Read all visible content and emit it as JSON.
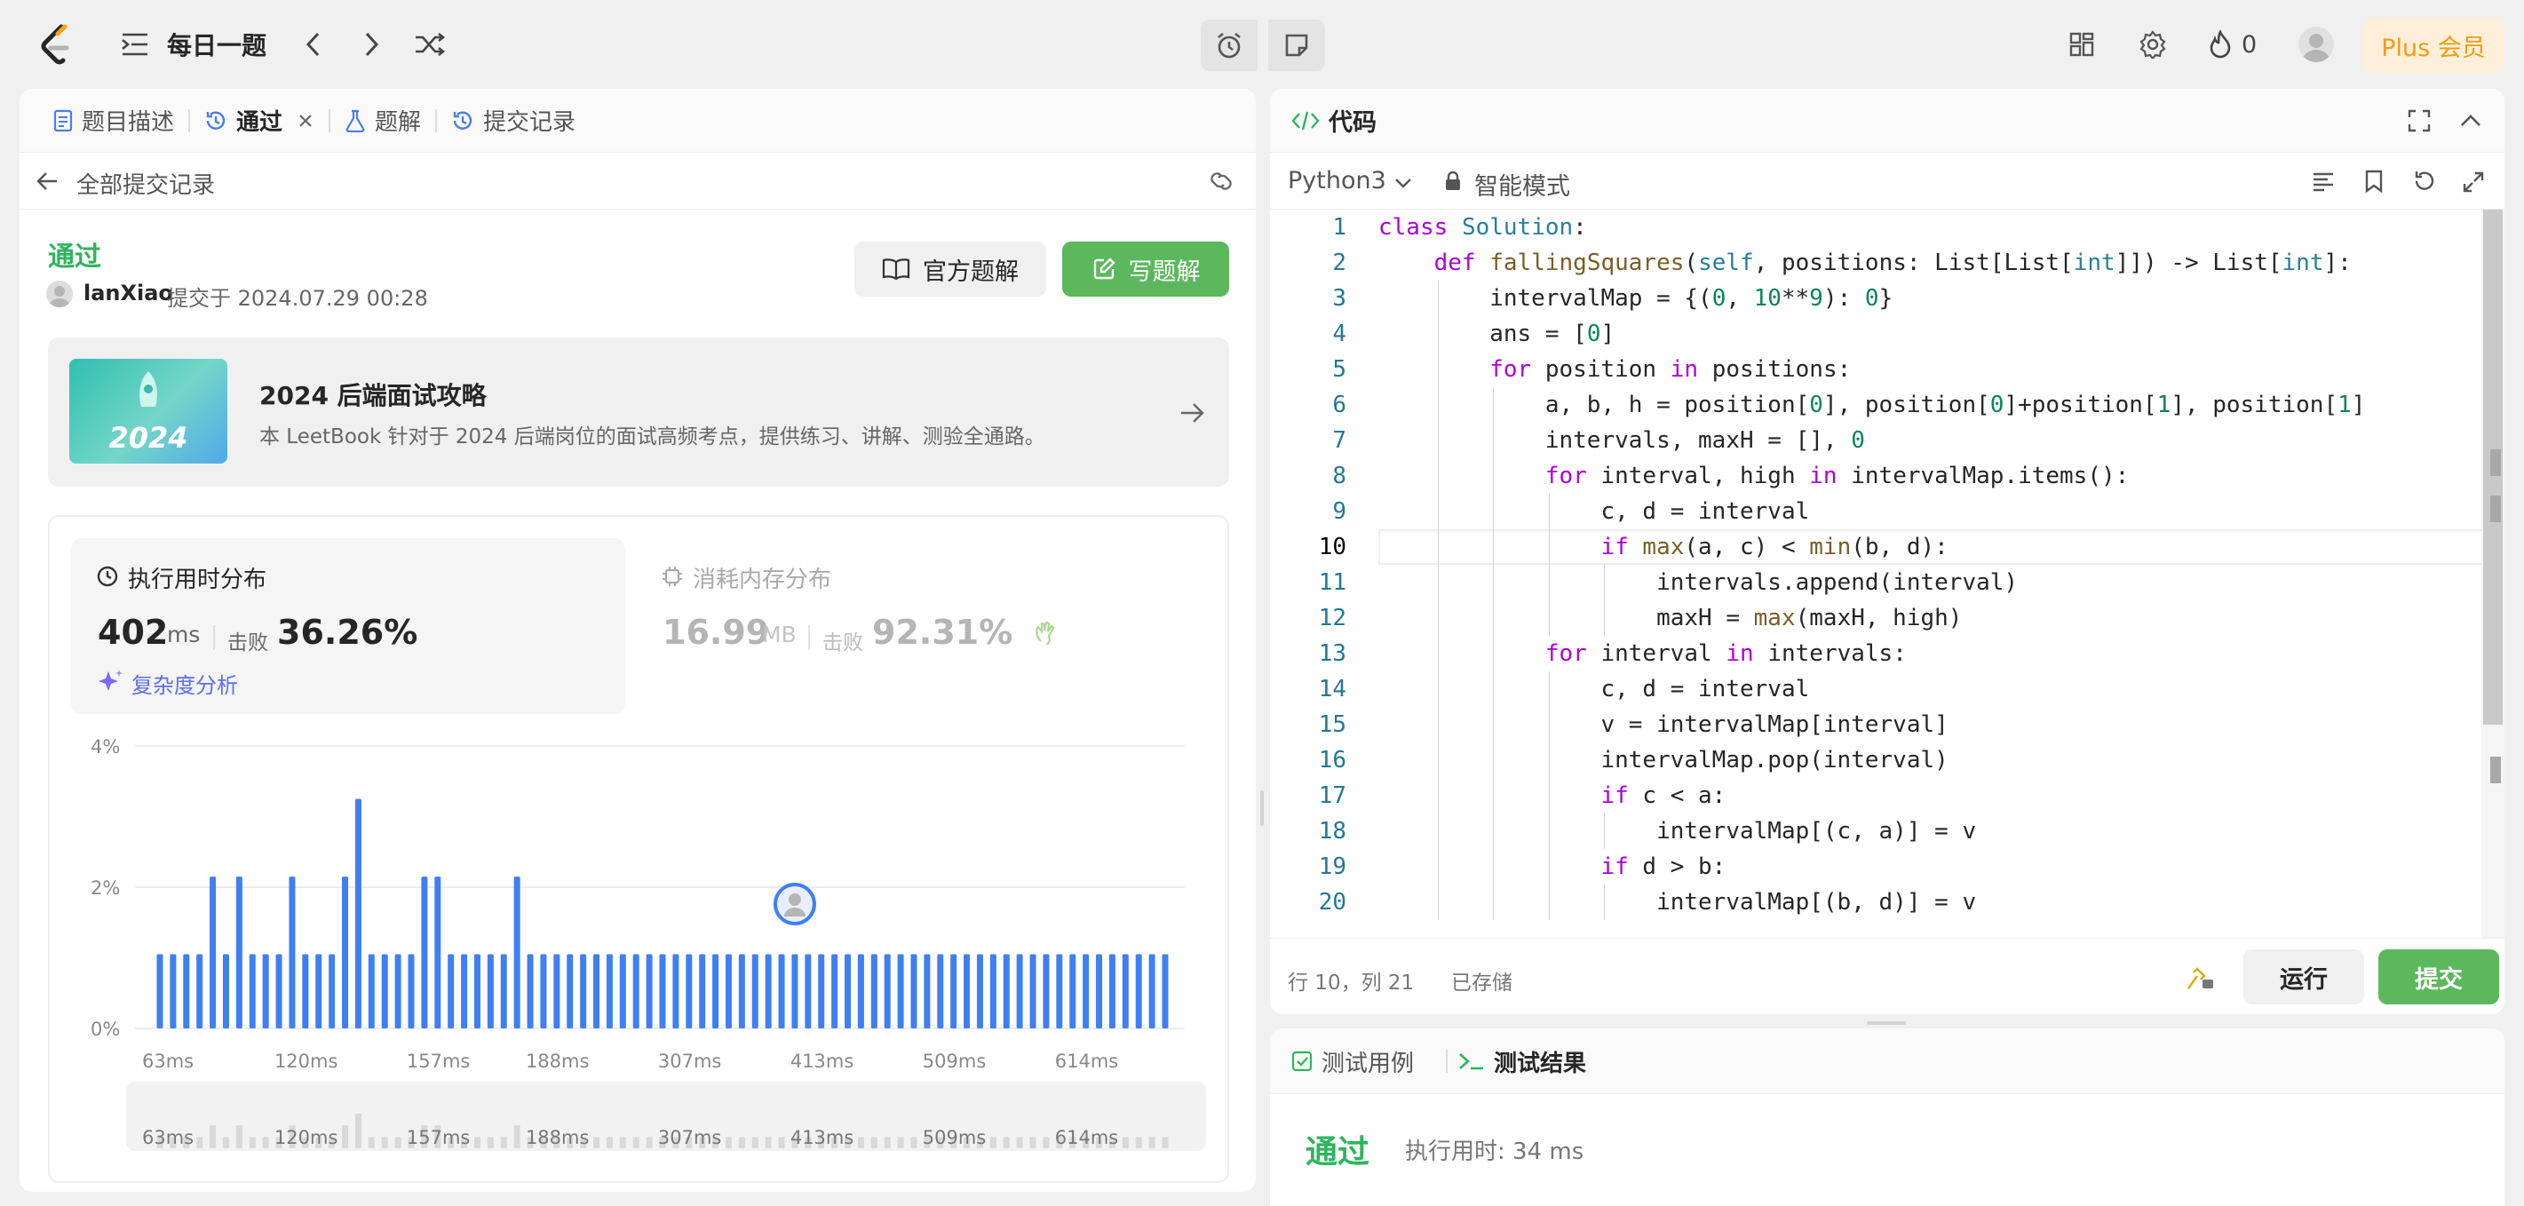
{
  "topbar": {
    "daily_label": "每日一题",
    "streak": "0",
    "plus_label": "Plus 会员"
  },
  "left_tabs": [
    {
      "label": "题目描述"
    },
    {
      "label": "通过"
    },
    {
      "label": "题解"
    },
    {
      "label": "提交记录"
    }
  ],
  "submission": {
    "back_label": "全部提交记录",
    "status": "通过",
    "user": "lanXiao",
    "submitted_at": "提交于 2024.07.29 00:28",
    "official_solution": "官方题解",
    "write_solution": "写题解"
  },
  "leetbook": {
    "cover_text": "2024",
    "title": "2024 后端面试攻略",
    "desc": "本 LeetBook 针对于 2024 后端岗位的面试高频考点，提供练习、讲解、测验全通路。"
  },
  "stats": {
    "runtime_title": "执行用时分布",
    "runtime_value": "402",
    "runtime_unit": "ms",
    "beat_label": "击败",
    "runtime_beat": "36.26%",
    "complexity_label": "复杂度分析",
    "memory_title": "消耗内存分布",
    "memory_value": "16.99",
    "memory_unit": "MB",
    "memory_beat": "92.31%"
  },
  "chart_data": {
    "type": "bar",
    "ylim": [
      0,
      4
    ],
    "yticks": [
      "4%",
      "2%",
      "0%"
    ],
    "xticks": [
      "63ms",
      "120ms",
      "157ms",
      "188ms",
      "307ms",
      "413ms",
      "509ms",
      "614ms"
    ],
    "values": [
      1.05,
      1.05,
      1.05,
      1.05,
      2.15,
      1.05,
      2.15,
      1.05,
      1.05,
      1.05,
      2.15,
      1.05,
      1.05,
      1.05,
      2.15,
      3.25,
      1.05,
      1.05,
      1.05,
      1.05,
      2.15,
      2.15,
      1.05,
      1.05,
      1.05,
      1.05,
      1.05,
      2.15,
      1.05,
      1.05,
      1.05,
      1.05,
      1.05,
      1.05,
      1.05,
      1.05,
      1.05,
      1.05,
      1.05,
      1.05,
      1.05,
      1.05,
      1.05,
      1.05,
      1.05,
      1.05,
      1.05,
      1.05,
      1.05,
      1.05,
      1.05,
      1.05,
      1.05,
      1.05,
      1.05,
      1.05,
      1.05,
      1.05,
      1.05,
      1.05,
      1.05,
      1.05,
      1.05,
      1.05,
      1.05,
      1.05,
      1.05,
      1.05,
      1.05,
      1.05,
      1.05,
      1.05,
      1.05,
      1.05,
      1.05,
      1.05,
      1.05
    ],
    "marker_index": 48
  },
  "code_panel": {
    "title": "代码",
    "language": "Python3",
    "mode": "智能模式",
    "status_pos": "行 10，列 21",
    "status_saved": "已存储",
    "run": "运行",
    "submit": "提交"
  },
  "code_lines": [
    "class Solution:",
    "    def fallingSquares(self, positions: List[List[int]]) -> List[int]:",
    "        intervalMap = {(0, 10**9): 0}",
    "        ans = [0]",
    "        for position in positions:",
    "            a, b, h = position[0], position[0]+position[1], position[1]",
    "            intervals, maxH = [], 0",
    "            for interval, high in intervalMap.items():",
    "                c, d = interval",
    "                if max(a, c) < min(b, d):",
    "                    intervals.append(interval)",
    "                    maxH = max(maxH, high)",
    "            for interval in intervals:",
    "                c, d = interval",
    "                v = intervalMap[interval]",
    "                intervalMap.pop(interval)",
    "                if c < a:",
    "                    intervalMap[(c, a)] = v",
    "                if d > b:",
    "                    intervalMap[(b, d)] = v"
  ],
  "result_panel": {
    "tab_testcase": "测试用例",
    "tab_result": "测试结果",
    "status": "通过",
    "runtime": "执行用时: 34 ms"
  }
}
